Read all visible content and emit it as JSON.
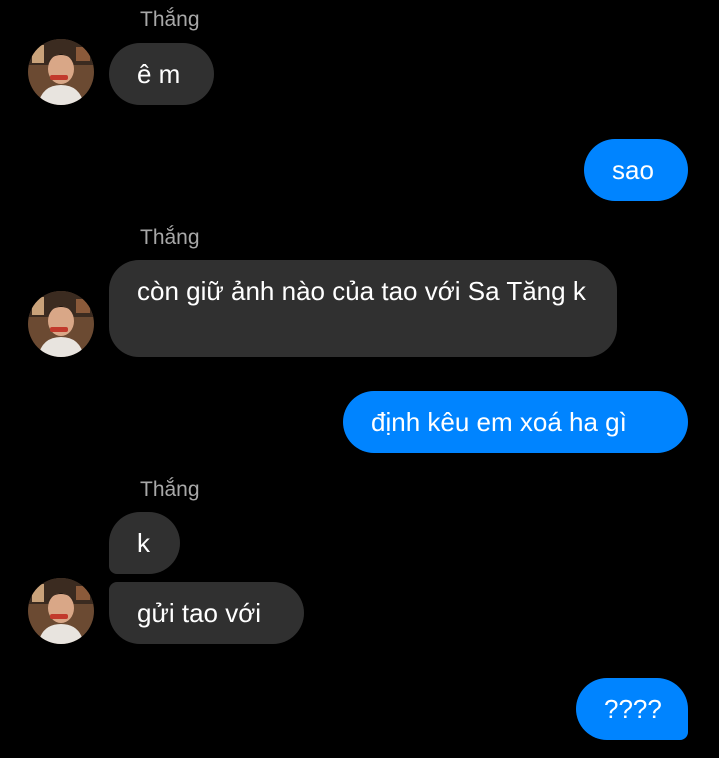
{
  "messages": [
    {
      "sender": "Thắng",
      "text": "ê m"
    },
    {
      "sender": "me",
      "text": "sao"
    },
    {
      "sender": "Thắng",
      "text": "còn giữ ảnh nào của tao với Sa Tăng k"
    },
    {
      "sender": "me",
      "text": "định kêu em xoá ha gì"
    },
    {
      "sender": "Thắng",
      "text": "k"
    },
    {
      "sender": "Thắng",
      "text": "gửi tao với"
    },
    {
      "sender": "me",
      "text": "????"
    }
  ],
  "names": {
    "group1": "Thắng",
    "group2": "Thắng",
    "group3": "Thắng"
  },
  "colors": {
    "background": "#000000",
    "incoming_bubble": "#303030",
    "outgoing_bubble": "#0084ff",
    "sender_name": "#a8a8a8"
  },
  "icons": {
    "avatar": "contact-avatar-photo"
  }
}
